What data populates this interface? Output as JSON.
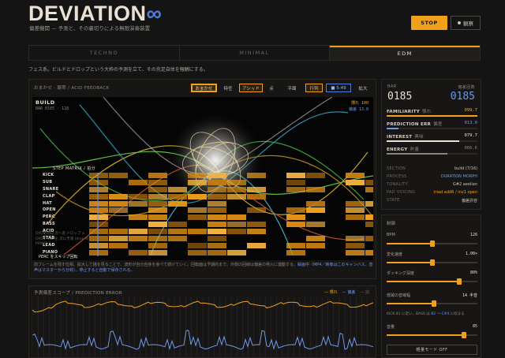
{
  "header": {
    "logo_text": "DEVIATION",
    "logo_mark": "∞",
    "subtitle": "偏差機関 — 予測と、その裏切りによる無限演奏装置",
    "stop_label": "STOP",
    "observe_label": "観察"
  },
  "modes": {
    "tabs": [
      {
        "label": "TECHNO",
        "active": false
      },
      {
        "label": "MINIMAL",
        "active": false
      },
      {
        "label": "EDM",
        "active": true
      }
    ],
    "description": "フェス系。ビルドとドロップという大枠の予測を立て、その充足自体を報酬にする。"
  },
  "viz": {
    "label": "おまかせ · 聴帯 / ACID FEEDBACK",
    "buttons": {
      "omakase": "おまかせ",
      "tokusei": "特任",
      "acid": "アシッド",
      "ten": "点",
      "heimen": "平面",
      "gyoretsu": "行列",
      "time": "■ 5:49",
      "kakudai": "拡大"
    },
    "section": "BUILD",
    "bar_line": "BAR 0185 · 128",
    "tr_expect": "慣れ 100",
    "tr_dev": "偏差 13.0",
    "matrix_title": "STEP MATRIX / 拍分",
    "rows": [
      "KICK",
      "SUB",
      "SNARE",
      "CLAP",
      "HAT",
      "OPEN",
      "PERC",
      "BASS",
      "ACID",
      "STAB",
      "LEAD",
      "PIANO"
    ],
    "overlay_lines": [
      "OPEN PAD 次へ進 ドロップ ±",
      "OPEN PAD を 次に予測 (drop 4)",
      "PIANO"
    ],
    "perc_note": "PERC をスキップ回転",
    "caption_prefix": "前フレームを残す位相、拡大して描を見ることで、波形が自分自身を食べて続けていく。回転面は予期的まで、外側の回線は偏差の発火に連動する。",
    "caption_em": "録画中（MP4／映像はこのキャンバス、音声はマスターから分岐）。停止すると自動で保存される。"
  },
  "scope": {
    "title": "予測偏差スコープ / PREDICTION ERROR",
    "legend": [
      "慣れ",
      "偏差",
      "拍"
    ]
  },
  "stats": {
    "bar_label": "BAR",
    "bar_value": "0185",
    "pred_label": "偏差回数",
    "pred_value": "0185",
    "metrics": [
      {
        "label": "FAMILIARITY",
        "sub": "慣れ",
        "value": "099.7",
        "fraction": 0.997,
        "color": "#f1a01a"
      },
      {
        "label": "PREDICTION ERR",
        "sub": "偏差",
        "value": "013.0",
        "fraction": 0.13,
        "color": "#6f98e8"
      },
      {
        "label": "INTEREST",
        "sub": "興味",
        "value": "079.7",
        "fraction": 0.797,
        "color": "#e9e2d2"
      },
      {
        "label": "ENERGY",
        "sub": "熱量",
        "value": "066.6",
        "fraction": 0.666,
        "color": "#8a847a"
      }
    ],
    "info": [
      {
        "key": "SECTION",
        "value": "build (7/16)",
        "color": "#c9c3b8"
      },
      {
        "key": "PROCESS",
        "value": "DURATION MORPH",
        "color": "#6f98e8"
      },
      {
        "key": "TONALITY",
        "value": "G#2 aeolian",
        "color": "#c9c3b8"
      },
      {
        "key": "PAD VOICING",
        "value": "triad add6 / inv1 open",
        "color": "#f1a01a"
      },
      {
        "key": "STATE",
        "value": "偏差許容",
        "color": "#c9c3b8"
      }
    ]
  },
  "controls": {
    "title": "制御",
    "sliders": [
      {
        "label": "BPM",
        "value": "126",
        "fraction": 0.5
      },
      {
        "label": "変化速度",
        "value": "1.00×",
        "fraction": 0.5
      },
      {
        "label": "ダッキング深度",
        "value": "80%",
        "fraction": 0.8
      },
      {
        "label": "低域の音域幅",
        "value": "14 半音",
        "fraction": 0.52
      }
    ],
    "kick_prefix": "KICK 81 に近い、BASS は ",
    "kick_em": "B2 〜 C#4",
    "kick_suffix": " に収まる",
    "volume": {
      "label": "音量",
      "value": "85",
      "fraction": 0.85
    },
    "light_button": "軽量モード OFF"
  },
  "colors": {
    "accent": "#f1a01a",
    "blue": "#6f98e8",
    "bg": "#141414"
  }
}
